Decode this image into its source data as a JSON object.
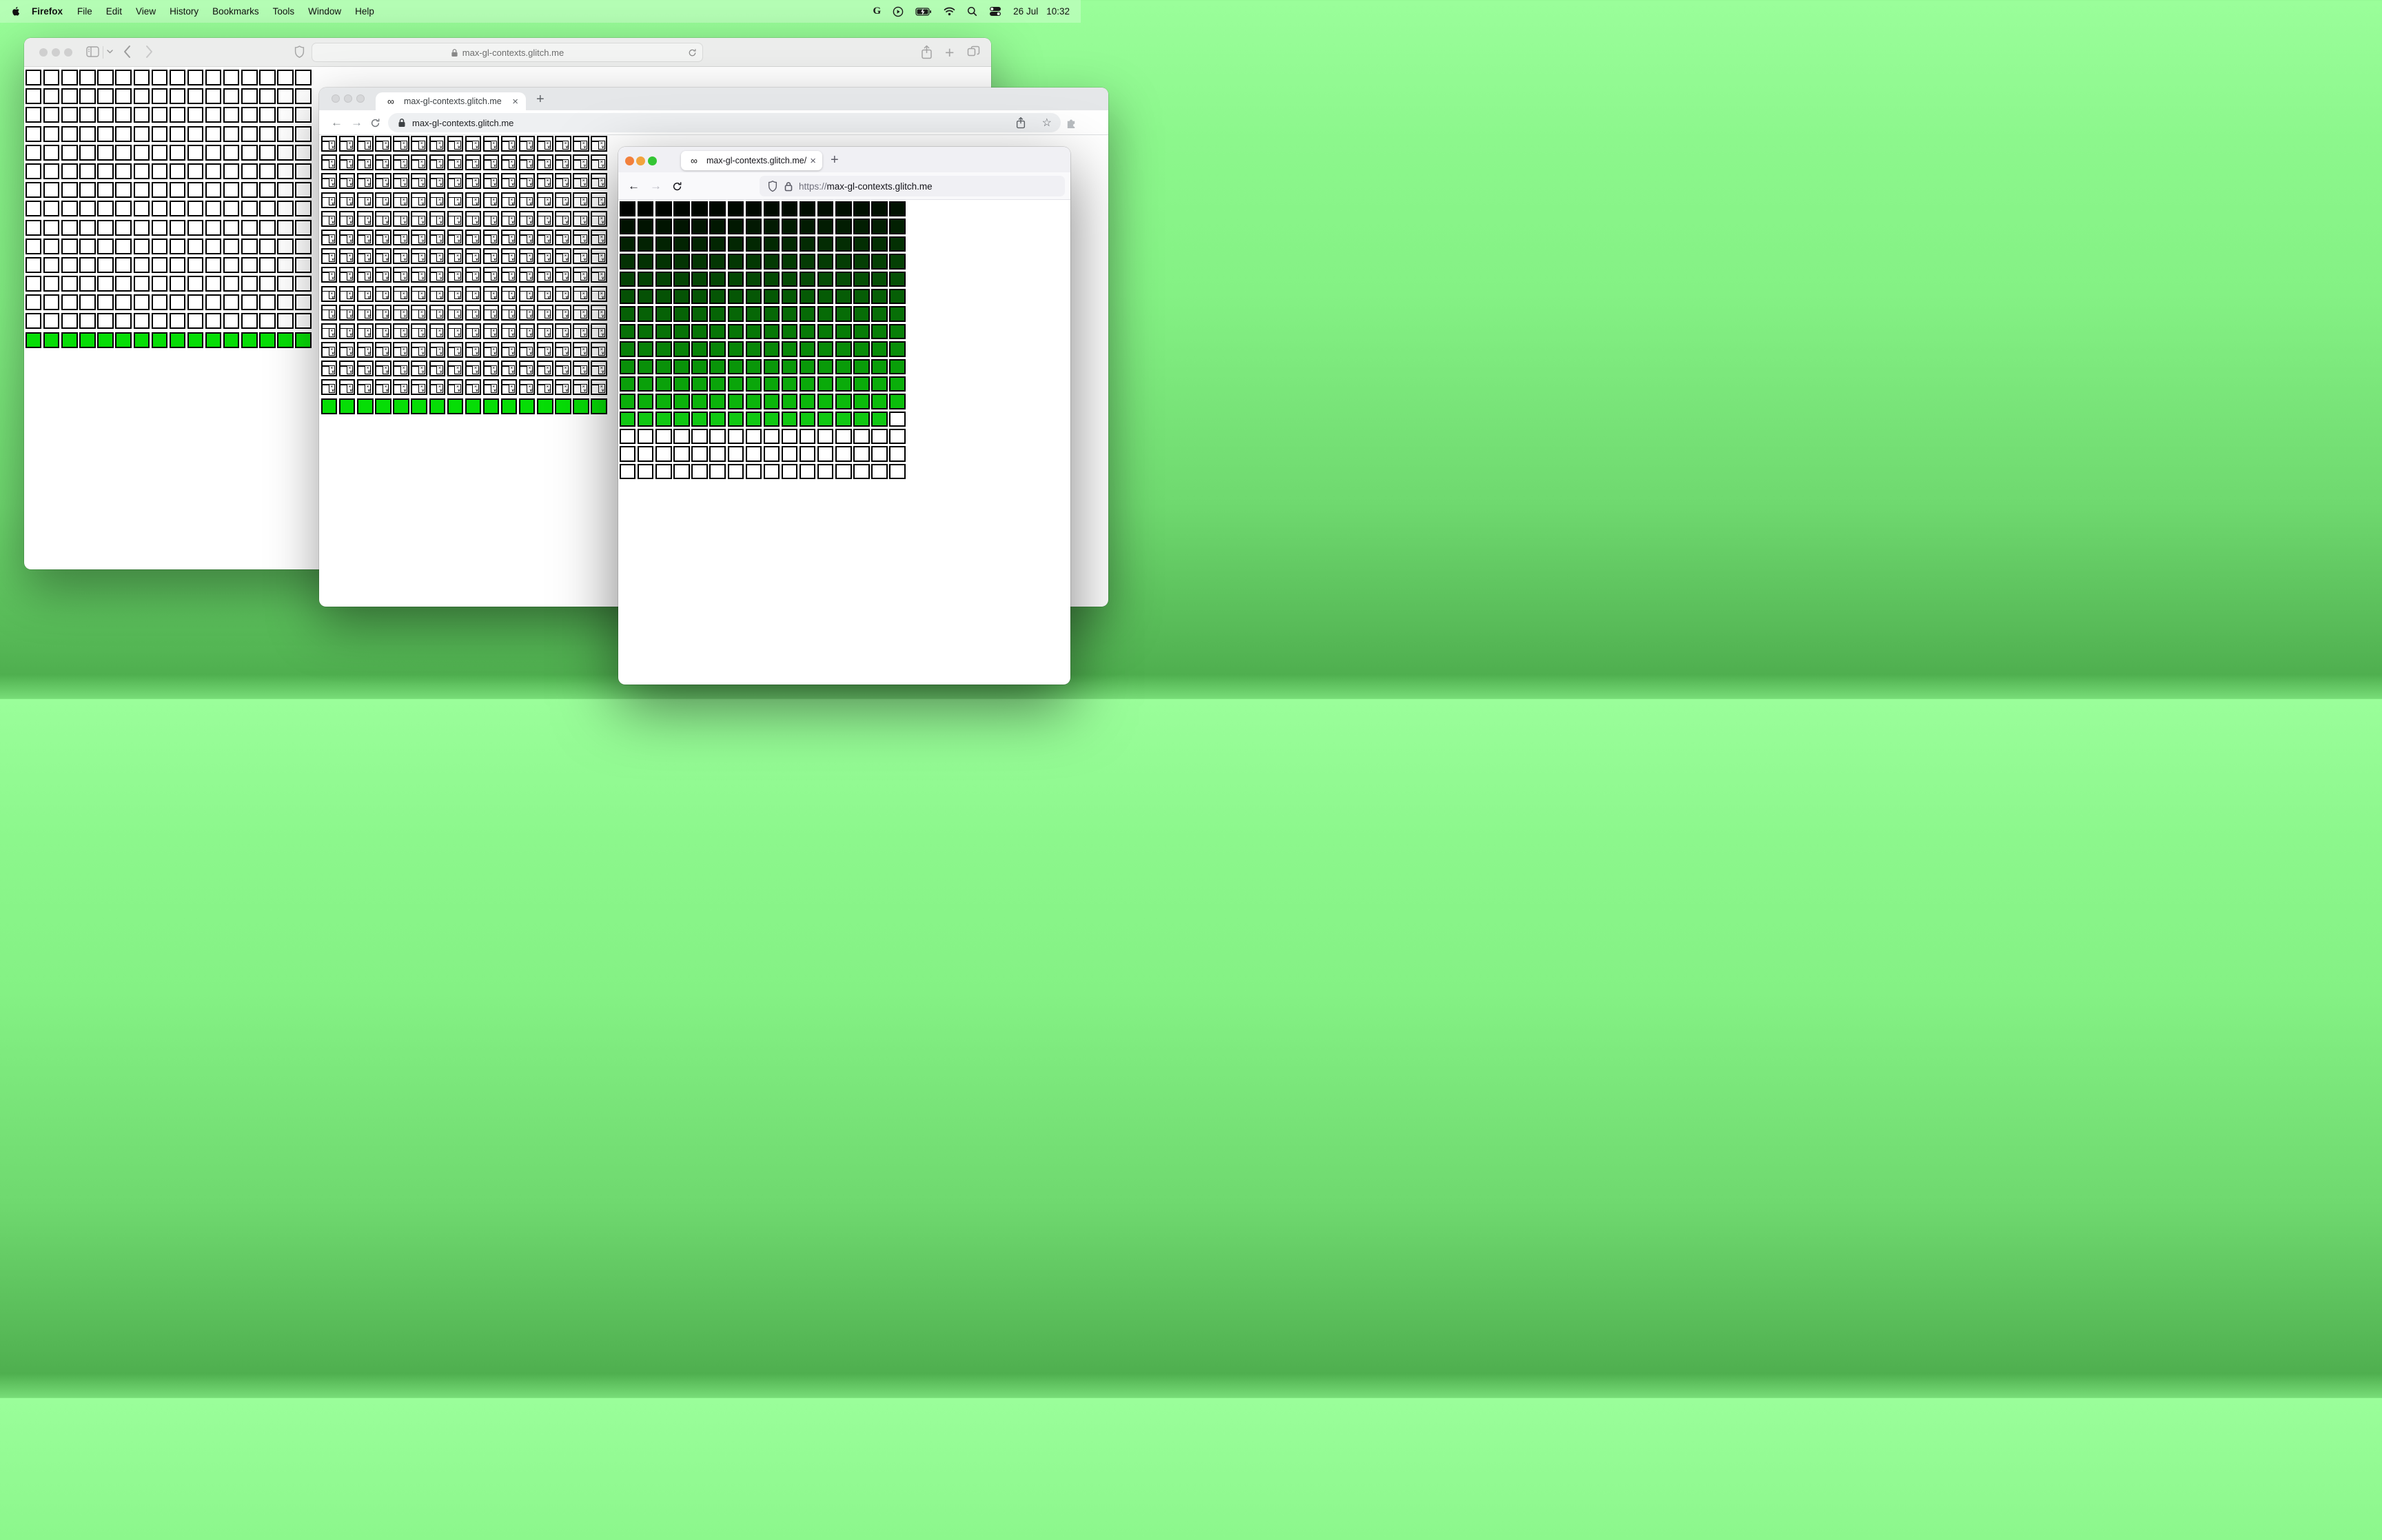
{
  "menu_bar": {
    "app_name": "Firefox",
    "menus": [
      "File",
      "Edit",
      "View",
      "History",
      "Bookmarks",
      "Tools",
      "Window",
      "Help"
    ],
    "date": "26 Jul",
    "time": "10:32",
    "status_icons": [
      "google-g",
      "play-badge",
      "battery-charging",
      "wifi",
      "spotlight-search",
      "control-center"
    ]
  },
  "safari_window": {
    "url": "max-gl-contexts.glitch.me",
    "toolbar_icons": [
      "sidebar",
      "chevron-down",
      "back",
      "forward",
      "privacy-shield",
      "lock",
      "reload",
      "share",
      "new-tab",
      "tab-overview"
    ]
  },
  "chrome_window": {
    "tab_title": "max-gl-contexts.glitch.me",
    "url": "max-gl-contexts.glitch.me",
    "tab_favicon": "∞",
    "toolbar_icons": [
      "back",
      "forward",
      "reload",
      "lock",
      "share",
      "bookmark-star",
      "extensions-puzzle"
    ]
  },
  "firefox_window": {
    "tab_title": "max-gl-contexts.glitch.me/",
    "url_scheme": "https://",
    "url_host": "max-gl-contexts.glitch.me",
    "tab_favicon": "∞",
    "toolbar_icons": [
      "back",
      "forward",
      "reload",
      "tracking-shield",
      "lock"
    ],
    "traffic_colors": [
      "#F2803C",
      "#F2A33C",
      "#34C534"
    ]
  },
  "grids": {
    "columns": 16,
    "lime_green": "#06DD06",
    "safari": {
      "empty_rows": 14,
      "green_rows": 1
    },
    "chrome": {
      "broken_image_rows": 14,
      "green_rows": 1
    },
    "firefox": {
      "gradient_rows": 12,
      "green_cells_in_next_row": 15,
      "empty_rows": 3,
      "gradient_from": "#020202",
      "gradient_to": "#00CC00",
      "green": "#10C812"
    }
  },
  "glyphs": {
    "infinity": "∞",
    "close": "×",
    "plus": "+",
    "back_arrow": "←",
    "forward_arrow": "→",
    "back_chevron": "‹",
    "forward_chevron": "›",
    "star": "☆"
  }
}
